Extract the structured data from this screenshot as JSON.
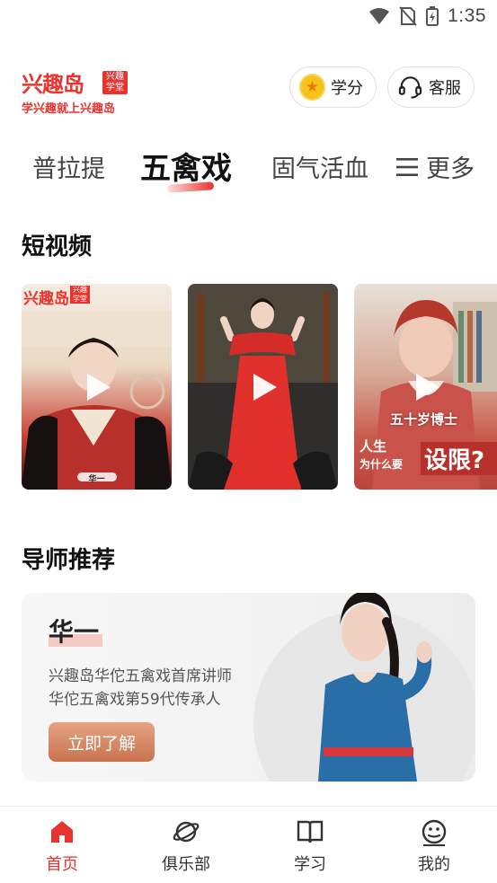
{
  "status_bar": {
    "time": "1:35"
  },
  "header": {
    "logo_text": "兴趣岛",
    "logo_badge": "兴趣学堂",
    "logo_slogan": "学兴趣就上兴趣岛",
    "credits_label": "学分",
    "service_label": "客服"
  },
  "tabs": [
    {
      "label": "普拉提",
      "active": false
    },
    {
      "label": "五禽戏",
      "active": true
    },
    {
      "label": "固气活血",
      "active": false
    },
    {
      "label": "更多",
      "active": false
    }
  ],
  "short_videos": {
    "title": "短视频",
    "items": [
      {
        "caption_top": "兴趣岛",
        "caption_badge": "兴趣学堂",
        "name_tag": "华一"
      },
      {
        "caption_top": "",
        "name_tag": ""
      },
      {
        "caption_main": "五十岁博士",
        "caption_line1": "人生",
        "caption_line2": "为什么要",
        "caption_big": "设限?"
      }
    ]
  },
  "mentor": {
    "title": "导师推荐",
    "name": "华一",
    "desc_line1": "兴趣岛华佗五禽戏首席讲师",
    "desc_line2": "华佗五禽戏第59代传承人",
    "button_label": "立即了解"
  },
  "bottom_nav": [
    {
      "label": "首页",
      "icon": "home-icon",
      "active": true
    },
    {
      "label": "俱乐部",
      "icon": "planet-icon",
      "active": false
    },
    {
      "label": "学习",
      "icon": "book-icon",
      "active": false
    },
    {
      "label": "我的",
      "icon": "smiley-icon",
      "active": false
    }
  ],
  "colors": {
    "accent": "#e8332f",
    "coin": "#f6c21b",
    "button": "#d08260"
  }
}
